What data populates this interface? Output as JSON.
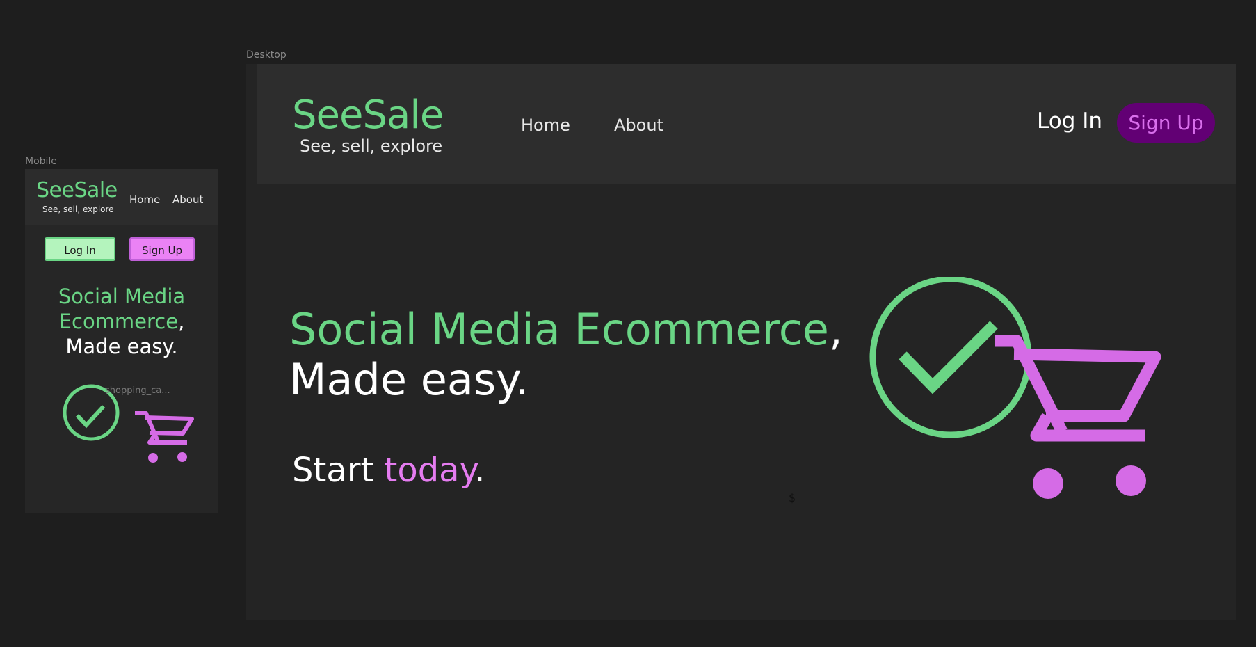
{
  "mobile": {
    "frame_label": "Mobile",
    "logo": "SeeSale",
    "tagline": "See, sell, explore",
    "nav": {
      "home": "Home",
      "about": "About"
    },
    "login_label": "Log In",
    "signup_label": "Sign Up",
    "hero": {
      "line1": "Social Media",
      "line2_green": "Ecommerce",
      "line2_comma": ",",
      "line3": "Made easy."
    },
    "graphic_label": "shopping_ca..."
  },
  "desktop": {
    "frame_label": "Desktop",
    "logo": "SeeSale",
    "tagline": "See, sell, explore",
    "nav": {
      "home": "Home",
      "about": "About"
    },
    "login_label": "Log In",
    "signup_label": "Sign Up",
    "hero": {
      "line1_green": "Social Media Ecommerce",
      "line1_comma": ",",
      "line2": "Made easy."
    },
    "cta": {
      "start": "Start ",
      "today": "today",
      "period": "."
    },
    "dollar_sign": "$"
  },
  "colors": {
    "background": "#1e1e1e",
    "brand_green": "#6ad585",
    "brand_pink": "#e57cf0",
    "signup_button_bg": "#620074"
  },
  "icons": [
    "check-circle-icon",
    "shopping-cart-icon"
  ]
}
